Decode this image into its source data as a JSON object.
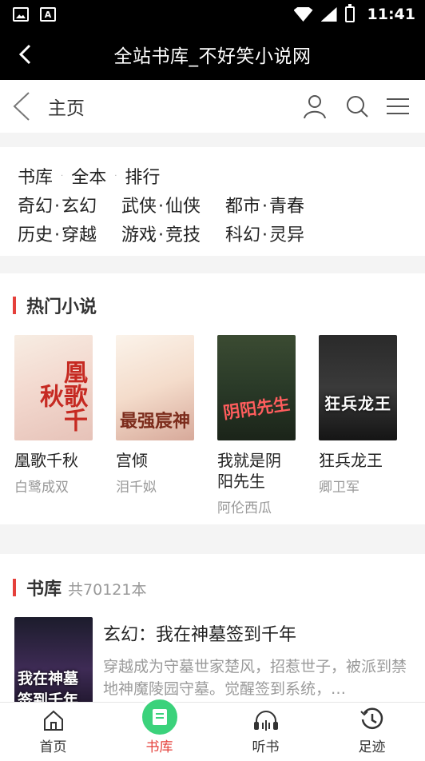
{
  "status_bar": {
    "time": "11:41",
    "icons": [
      "image-icon",
      "a-icon",
      "wifi-icon",
      "signal-icon",
      "battery-icon"
    ]
  },
  "app_bar": {
    "title": "全站书库_不好笑小说网"
  },
  "page_header": {
    "title": "主页",
    "icons": [
      "back-icon",
      "user-icon",
      "search-icon",
      "menu-icon"
    ]
  },
  "nav": {
    "row1": [
      "书库",
      "全本",
      "排行"
    ],
    "row2": [
      [
        "奇幻",
        "玄幻"
      ],
      [
        "武侠",
        "仙侠"
      ],
      [
        "都市",
        "青春"
      ]
    ],
    "row3": [
      [
        "历史",
        "穿越"
      ],
      [
        "游戏",
        "竞技"
      ],
      [
        "科幻",
        "灵异"
      ]
    ],
    "separator": "·"
  },
  "hot": {
    "title": "热门小说",
    "books": [
      {
        "name": "凰歌千秋",
        "author": "白鹭成双",
        "cover_text": "凰歌千秋"
      },
      {
        "name": "宫倾",
        "author": "泪千姒",
        "cover_text": "最强宸神"
      },
      {
        "name": "我就是阴阳先生",
        "author": "阿伦西瓜",
        "cover_text": "阴阳先生"
      },
      {
        "name": "狂兵龙王",
        "author": "卿卫军",
        "cover_text": "狂兵龙王"
      }
    ]
  },
  "library": {
    "title": "书库",
    "count": "共70121本",
    "items": [
      {
        "title": "玄幻：我在神墓签到千年",
        "desc": "穿越成为守墓世家楚风，招惹世子，被派到禁地神魔陵园守墓。觉醒签到系统，…",
        "cover_text": "我在神墓签到千年"
      }
    ]
  },
  "tabbar": {
    "tabs": [
      {
        "label": "首页",
        "icon": "home-icon"
      },
      {
        "label": "书库",
        "icon": "book-icon"
      },
      {
        "label": "听书",
        "icon": "headphones-icon"
      },
      {
        "label": "足迹",
        "icon": "history-icon"
      }
    ],
    "active": 1
  },
  "colors": {
    "accent": "#e5403b",
    "active_tab": "#3bd27b",
    "appbar": "#000000"
  }
}
